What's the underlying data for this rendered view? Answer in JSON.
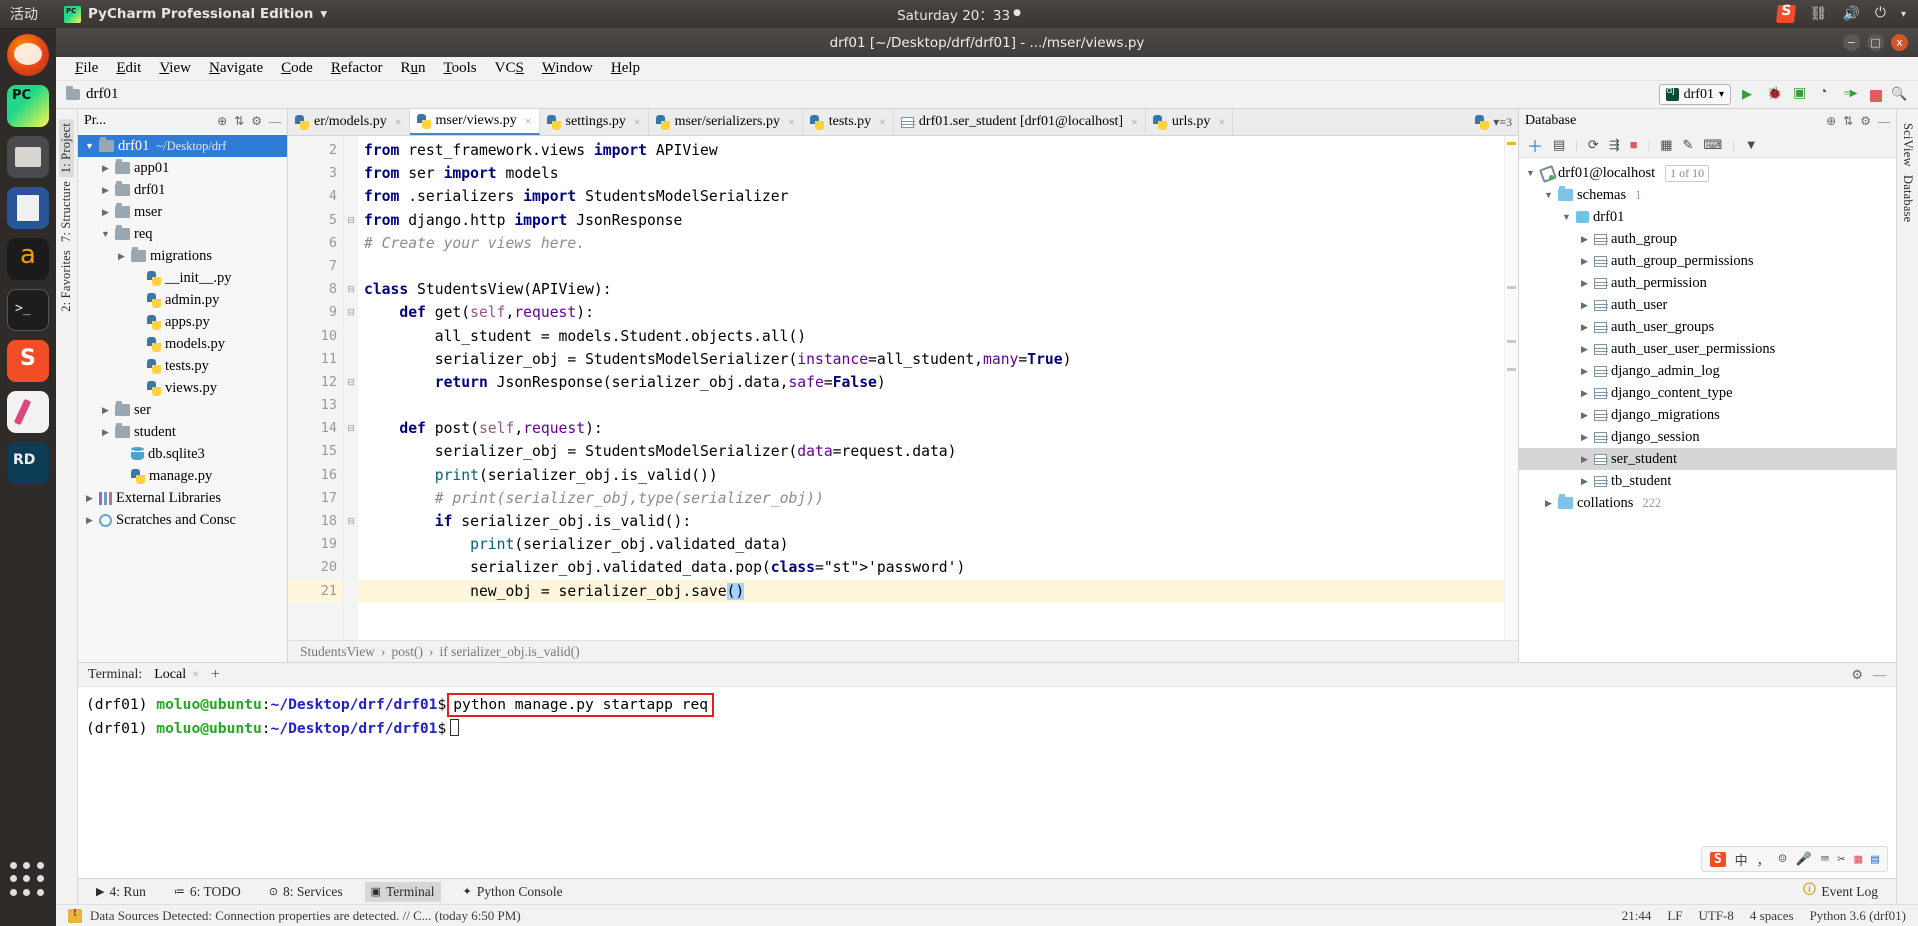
{
  "os_bar": {
    "activities": "活动",
    "app_menu": "PyCharm Professional Edition",
    "app_menu_caret": "▾",
    "clock": "Saturday 20：33",
    "tray": [
      {
        "name": "sogou-input-icon",
        "label": "S"
      },
      {
        "name": "network-icon",
        "label": "⇄"
      },
      {
        "name": "volume-icon",
        "label": "🔊"
      },
      {
        "name": "power-icon",
        "label": "⏻"
      },
      {
        "name": "caret-down-icon",
        "label": "▾"
      }
    ]
  },
  "dock": [
    {
      "name": "dock-firefox",
      "label": "Firefox"
    },
    {
      "name": "dock-pycharm",
      "label": "PyCharm"
    },
    {
      "name": "dock-files",
      "label": "Files"
    },
    {
      "name": "dock-writer",
      "label": "Writer"
    },
    {
      "name": "dock-amazon",
      "label": "Amazon"
    },
    {
      "name": "dock-terminal",
      "label": "Terminal"
    },
    {
      "name": "dock-sogou",
      "label": "Sogou"
    },
    {
      "name": "dock-paint",
      "label": "Paint"
    },
    {
      "name": "dock-rd",
      "label": "RD"
    }
  ],
  "window": {
    "title": "drf01 [~/Desktop/drf/drf01] - .../mser/views.py",
    "buttons": {
      "minimize": "−",
      "maximize": "□",
      "close": "x"
    }
  },
  "menu": [
    {
      "label": "File",
      "mnemonic": "F"
    },
    {
      "label": "Edit",
      "mnemonic": "E"
    },
    {
      "label": "View",
      "mnemonic": "V"
    },
    {
      "label": "Navigate",
      "mnemonic": "N"
    },
    {
      "label": "Code",
      "mnemonic": "C"
    },
    {
      "label": "Refactor",
      "mnemonic": "R"
    },
    {
      "label": "Run",
      "mnemonic": "u"
    },
    {
      "label": "Tools",
      "mnemonic": "T"
    },
    {
      "label": "VCS",
      "mnemonic": "S"
    },
    {
      "label": "Window",
      "mnemonic": "W"
    },
    {
      "label": "Help",
      "mnemonic": "H"
    }
  ],
  "navbar": {
    "breadcrumb": "drf01",
    "run_config": "drf01",
    "run_config_caret": "▾",
    "actions": [
      "run-button",
      "debug-button",
      "run-coverage-button",
      "profile-button",
      "run-with-console-button",
      "stop-button",
      "search-everywhere-button"
    ]
  },
  "left_rail": [
    {
      "label": "1: Project",
      "active": true
    },
    {
      "label": "7: Structure",
      "active": false
    },
    {
      "label": "2: Favorites",
      "active": false
    }
  ],
  "right_rail": [
    {
      "label": "SciView",
      "active": false
    },
    {
      "label": "Database",
      "active": false
    }
  ],
  "project": {
    "title": "Pr...",
    "tree": [
      {
        "label": "drf01",
        "sub": "~/Desktop/drf",
        "indent": 0,
        "arrow": "▼",
        "icon": "folder",
        "selected": true
      },
      {
        "label": "app01",
        "sub": "",
        "indent": 1,
        "arrow": "▶",
        "icon": "folder",
        "selected": false
      },
      {
        "label": "drf01",
        "sub": "",
        "indent": 1,
        "arrow": "▶",
        "icon": "folder",
        "selected": false
      },
      {
        "label": "mser",
        "sub": "",
        "indent": 1,
        "arrow": "▶",
        "icon": "folder",
        "selected": false
      },
      {
        "label": "req",
        "sub": "",
        "indent": 1,
        "arrow": "▼",
        "icon": "folder",
        "selected": false
      },
      {
        "label": "migrations",
        "sub": "",
        "indent": 2,
        "arrow": "▶",
        "icon": "folder",
        "selected": false
      },
      {
        "label": "__init__.py",
        "sub": "",
        "indent": 3,
        "arrow": "",
        "icon": "python",
        "selected": false
      },
      {
        "label": "admin.py",
        "sub": "",
        "indent": 3,
        "arrow": "",
        "icon": "python",
        "selected": false
      },
      {
        "label": "apps.py",
        "sub": "",
        "indent": 3,
        "arrow": "",
        "icon": "python",
        "selected": false
      },
      {
        "label": "models.py",
        "sub": "",
        "indent": 3,
        "arrow": "",
        "icon": "python",
        "selected": false
      },
      {
        "label": "tests.py",
        "sub": "",
        "indent": 3,
        "arrow": "",
        "icon": "python",
        "selected": false
      },
      {
        "label": "views.py",
        "sub": "",
        "indent": 3,
        "arrow": "",
        "icon": "python",
        "selected": false
      },
      {
        "label": "ser",
        "sub": "",
        "indent": 1,
        "arrow": "▶",
        "icon": "folder",
        "selected": false
      },
      {
        "label": "student",
        "sub": "",
        "indent": 1,
        "arrow": "▶",
        "icon": "folder",
        "selected": false
      },
      {
        "label": "db.sqlite3",
        "sub": "",
        "indent": 2,
        "arrow": "",
        "icon": "db",
        "selected": false
      },
      {
        "label": "manage.py",
        "sub": "",
        "indent": 2,
        "arrow": "",
        "icon": "python",
        "selected": false
      },
      {
        "label": "External Libraries",
        "sub": "",
        "indent": 0,
        "arrow": "▶",
        "icon": "lib",
        "selected": false
      },
      {
        "label": "Scratches and Consc",
        "sub": "",
        "indent": 0,
        "arrow": "▶",
        "icon": "scratch",
        "selected": false
      }
    ]
  },
  "editor": {
    "tabs": [
      {
        "label": "er/models.py",
        "icon": "python",
        "active": false
      },
      {
        "label": "mser/views.py",
        "icon": "python",
        "active": true
      },
      {
        "label": "settings.py",
        "icon": "python",
        "active": false
      },
      {
        "label": "mser/serializers.py",
        "icon": "python",
        "active": false
      },
      {
        "label": "tests.py",
        "icon": "python",
        "active": false
      },
      {
        "label": "drf01.ser_student [drf01@localhost]",
        "icon": "table",
        "active": false
      },
      {
        "label": "urls.py",
        "icon": "python",
        "active": false
      }
    ],
    "tabs_overflow": "≡3",
    "first_line_number": 2,
    "lines": [
      {
        "n": 2,
        "fold": "",
        "hl": false
      },
      {
        "n": 3,
        "fold": "",
        "hl": false
      },
      {
        "n": 4,
        "fold": "",
        "hl": false
      },
      {
        "n": 5,
        "fold": "⊟",
        "hl": false
      },
      {
        "n": 6,
        "fold": "",
        "hl": false
      },
      {
        "n": 7,
        "fold": "",
        "hl": false
      },
      {
        "n": 8,
        "fold": "⊟",
        "hl": false
      },
      {
        "n": 9,
        "fold": "⊟",
        "hl": false
      },
      {
        "n": 10,
        "fold": "",
        "hl": false
      },
      {
        "n": 11,
        "fold": "",
        "hl": false
      },
      {
        "n": 12,
        "fold": "⊟",
        "hl": false
      },
      {
        "n": 13,
        "fold": "",
        "hl": false
      },
      {
        "n": 14,
        "fold": "⊟",
        "hl": false
      },
      {
        "n": 15,
        "fold": "",
        "hl": false
      },
      {
        "n": 16,
        "fold": "",
        "hl": false
      },
      {
        "n": 17,
        "fold": "",
        "hl": false
      },
      {
        "n": 18,
        "fold": "⊟",
        "hl": false
      },
      {
        "n": 19,
        "fold": "",
        "hl": false
      },
      {
        "n": 20,
        "fold": "",
        "hl": false
      },
      {
        "n": 21,
        "fold": "",
        "hl": true
      }
    ],
    "code_text": [
      "from rest_framework.views import APIView",
      "from ser import models",
      "from .serializers import StudentsModelSerializer",
      "from django.http import JsonResponse",
      "# Create your views here.",
      "",
      "class StudentsView(APIView):",
      "    def get(self,request):",
      "        all_student = models.Student.objects.all()",
      "        serializer_obj = StudentsModelSerializer(instance=all_student,many=True)",
      "        return JsonResponse(serializer_obj.data,safe=False)",
      "",
      "    def post(self,request):",
      "        serializer_obj = StudentsModelSerializer(data=request.data)",
      "        print(serializer_obj.is_valid())",
      "        # print(serializer_obj,type(serializer_obj))",
      "        if serializer_obj.is_valid():",
      "            print(serializer_obj.validated_data)",
      "            serializer_obj.validated_data.pop('password')",
      "            new_obj = serializer_obj.save()"
    ],
    "breadcrumbs": [
      "StudentsView",
      "post()",
      "if serializer_obj.is_valid()"
    ]
  },
  "database": {
    "title": "Database",
    "toolbar": [
      "add-icon",
      "copy-icon",
      "refresh-icon",
      "run-sql-icon",
      "stop-icon",
      "table-editor-icon",
      "edit-icon",
      "query-console-icon",
      "filter-icon"
    ],
    "tree": [
      {
        "label": "drf01@localhost",
        "indent": 0,
        "arrow": "▼",
        "icon": "conn",
        "chip": "1 of 10",
        "count": "",
        "selected": false
      },
      {
        "label": "schemas",
        "indent": 1,
        "arrow": "▼",
        "icon": "folder-blue",
        "chip": "",
        "count": "1",
        "selected": false
      },
      {
        "label": "drf01",
        "indent": 2,
        "arrow": "▼",
        "icon": "schema",
        "chip": "",
        "count": "",
        "selected": false
      },
      {
        "label": "auth_group",
        "indent": 3,
        "arrow": "▶",
        "icon": "table",
        "chip": "",
        "count": "",
        "selected": false
      },
      {
        "label": "auth_group_permissions",
        "indent": 3,
        "arrow": "▶",
        "icon": "table",
        "chip": "",
        "count": "",
        "selected": false
      },
      {
        "label": "auth_permission",
        "indent": 3,
        "arrow": "▶",
        "icon": "table",
        "chip": "",
        "count": "",
        "selected": false
      },
      {
        "label": "auth_user",
        "indent": 3,
        "arrow": "▶",
        "icon": "table",
        "chip": "",
        "count": "",
        "selected": false
      },
      {
        "label": "auth_user_groups",
        "indent": 3,
        "arrow": "▶",
        "icon": "table",
        "chip": "",
        "count": "",
        "selected": false
      },
      {
        "label": "auth_user_user_permissions",
        "indent": 3,
        "arrow": "▶",
        "icon": "table",
        "chip": "",
        "count": "",
        "selected": false
      },
      {
        "label": "django_admin_log",
        "indent": 3,
        "arrow": "▶",
        "icon": "table",
        "chip": "",
        "count": "",
        "selected": false
      },
      {
        "label": "django_content_type",
        "indent": 3,
        "arrow": "▶",
        "icon": "table",
        "chip": "",
        "count": "",
        "selected": false
      },
      {
        "label": "django_migrations",
        "indent": 3,
        "arrow": "▶",
        "icon": "table",
        "chip": "",
        "count": "",
        "selected": false
      },
      {
        "label": "django_session",
        "indent": 3,
        "arrow": "▶",
        "icon": "table",
        "chip": "",
        "count": "",
        "selected": false
      },
      {
        "label": "ser_student",
        "indent": 3,
        "arrow": "▶",
        "icon": "table",
        "chip": "",
        "count": "",
        "selected": true
      },
      {
        "label": "tb_student",
        "indent": 3,
        "arrow": "▶",
        "icon": "table",
        "chip": "",
        "count": "",
        "selected": false
      },
      {
        "label": "collations",
        "indent": 1,
        "arrow": "▶",
        "icon": "folder-blue",
        "chip": "",
        "count": "222",
        "selected": false
      }
    ]
  },
  "terminal": {
    "label": "Terminal:",
    "tab": "Local",
    "tab_close": "×",
    "new_tab": "+",
    "lines": [
      {
        "env": "(drf01) ",
        "user": "moluo@ubuntu",
        "sep": ":",
        "path": "~/Desktop/drf/drf01",
        "dollar": "$",
        "command": "python manage.py startapp req",
        "boxed": true,
        "cursor": false
      },
      {
        "env": "(drf01) ",
        "user": "moluo@ubuntu",
        "sep": ":",
        "path": "~/Desktop/drf/drf01",
        "dollar": "$",
        "command": "",
        "boxed": false,
        "cursor": true
      }
    ],
    "ime": {
      "s": "S",
      "lang": "中",
      "items": [
        "⌨",
        "☺",
        "🎤",
        "⌧",
        "✂",
        "▦",
        "▤"
      ]
    }
  },
  "tool_window_bar": {
    "left": [
      {
        "label": "4: Run",
        "icon": "run-icon",
        "active": false
      },
      {
        "label": "6: TODO",
        "icon": "todo-icon",
        "active": false
      },
      {
        "label": "8: Services",
        "icon": "services-icon",
        "active": false
      },
      {
        "label": "Terminal",
        "icon": "terminal-icon",
        "active": true
      },
      {
        "label": "Python Console",
        "icon": "python-console-icon",
        "active": false
      }
    ],
    "right": [
      {
        "label": "Event Log",
        "icon": "event-log-icon"
      }
    ]
  },
  "statusbar": {
    "message": "Data Sources Detected: Connection properties are detected. // C... (today 6:50 PM)",
    "right": [
      "21:44",
      "LF",
      "UTF-8",
      "4 spaces",
      "Python 3.6 (drf01)"
    ]
  }
}
